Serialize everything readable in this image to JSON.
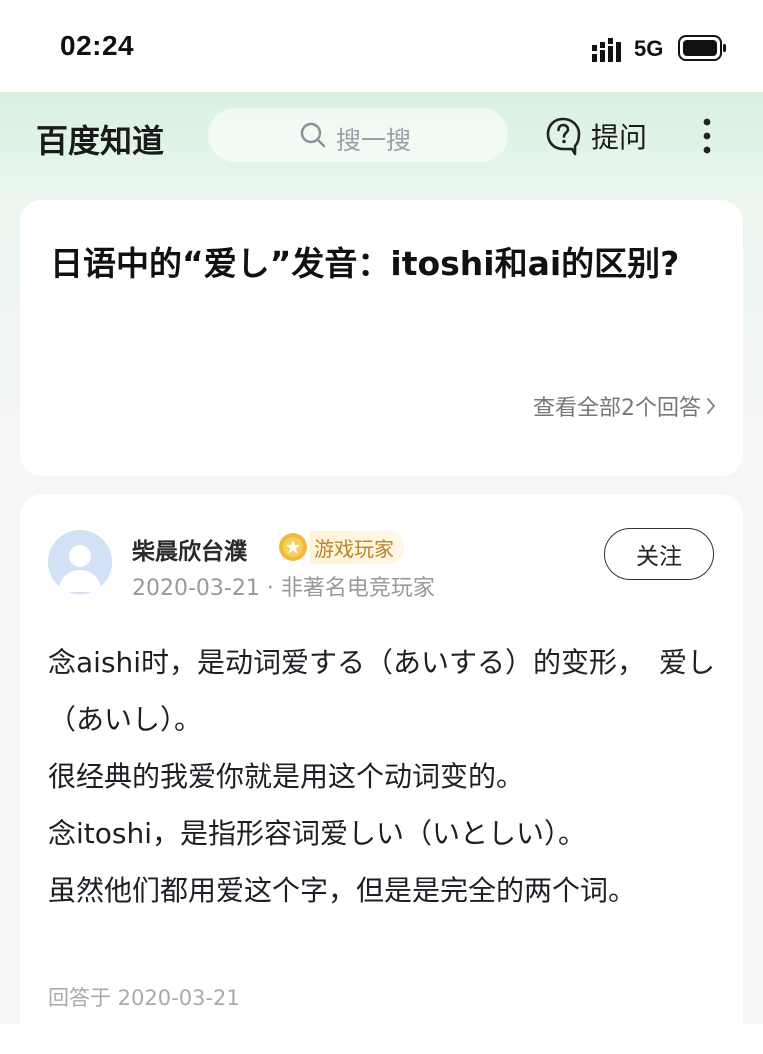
{
  "status_bar": {
    "time": "02:24",
    "network": "5G"
  },
  "header": {
    "brand": "百度知道",
    "search_placeholder": "搜一搜",
    "ask_label": "提问"
  },
  "question": {
    "title": "日语中的“爱し”发音：itoshi和ai的区别?",
    "view_all": "查看全部2个回答"
  },
  "answer": {
    "user_name": "柴晨欣台濮",
    "badge": "游戏玩家",
    "meta": "2020-03-21 · 非著名电竞玩家",
    "follow_label": "关注",
    "paragraphs": [
      "念aishi时，是动词爱する（あいする）的变形，　爱し（あいし）。",
      "很经典的我爱你就是用这个动词变的。",
      "念itoshi，是指形容词爱しい（いとしい）。",
      "虽然他们都用爱这个字，但是是完全的两个词。"
    ],
    "answered_at": "回答于 2020-03-21"
  },
  "colors": {
    "accent_green": "#d9f1df",
    "badge_gold": "#e8b23a"
  }
}
